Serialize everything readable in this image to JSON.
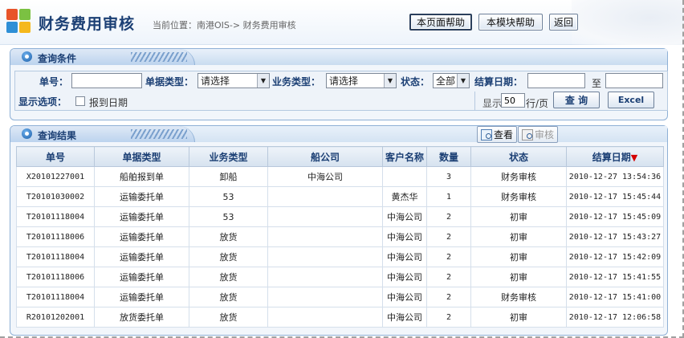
{
  "header": {
    "title": "财务费用审核",
    "breadcrumb": "当前位置：南港OIS-> 财务费用审核",
    "buttons": [
      "本页面帮助",
      "本模块帮助",
      "返回"
    ]
  },
  "query_panel": {
    "title": "查询条件",
    "fields": {
      "doc_no_label": "单号：",
      "doc_type_label": "单据类型：",
      "doc_type_value": "请选择",
      "biz_type_label": "业务类型：",
      "biz_type_value": "请选择",
      "status_label": "状态：",
      "status_value": "全部",
      "settle_date_label": "结算日期：",
      "to_label": "至",
      "display_label": "显示选项：",
      "report_date_label": "报到日期",
      "page_show_label": "显示",
      "page_size": "50",
      "per_page_label": "行/页"
    },
    "search_button": "查 询",
    "excel_button": "Excel"
  },
  "results_panel": {
    "title": "查询结果",
    "view_button": "查看",
    "audit_button": "审核",
    "columns": [
      "单号",
      "单据类型",
      "业务类型",
      "船公司",
      "客户名称",
      "数量",
      "状态",
      "结算日期"
    ],
    "sort_indicator": "▼",
    "rows": [
      [
        "X20101227001",
        "船舶报到单",
        "卸船",
        "中海公司",
        "",
        "3",
        "财务审核",
        "2010-12-27 13:54:36"
      ],
      [
        "T20101030002",
        "运输委托单",
        "53",
        "",
        "黄杰华",
        "1",
        "财务审核",
        "2010-12-17 15:45:44"
      ],
      [
        "T20101118004",
        "运输委托单",
        "53",
        "",
        "中海公司",
        "2",
        "初审",
        "2010-12-17 15:45:09"
      ],
      [
        "T20101118006",
        "运输委托单",
        "放货",
        "",
        "中海公司",
        "2",
        "初审",
        "2010-12-17 15:43:27"
      ],
      [
        "T20101118004",
        "运输委托单",
        "放货",
        "",
        "中海公司",
        "2",
        "初审",
        "2010-12-17 15:42:09"
      ],
      [
        "T20101118006",
        "运输委托单",
        "放货",
        "",
        "中海公司",
        "2",
        "初审",
        "2010-12-17 15:41:55"
      ],
      [
        "T20101118004",
        "运输委托单",
        "放货",
        "",
        "中海公司",
        "2",
        "财务审核",
        "2010-12-17 15:41:00"
      ],
      [
        "R20101202001",
        "放货委托单",
        "放货",
        "",
        "中海公司",
        "2",
        "初审",
        "2010-12-17 12:06:58"
      ]
    ]
  },
  "icons": {
    "logo": "office-logo-icon",
    "panel": "panel-circle-icon",
    "view": "magnifier-icon",
    "audit": "edit-icon"
  },
  "colors": {
    "title": "#1b3f74",
    "panel_border": "#8eb0d6",
    "sort_arrow": "#d40000"
  }
}
